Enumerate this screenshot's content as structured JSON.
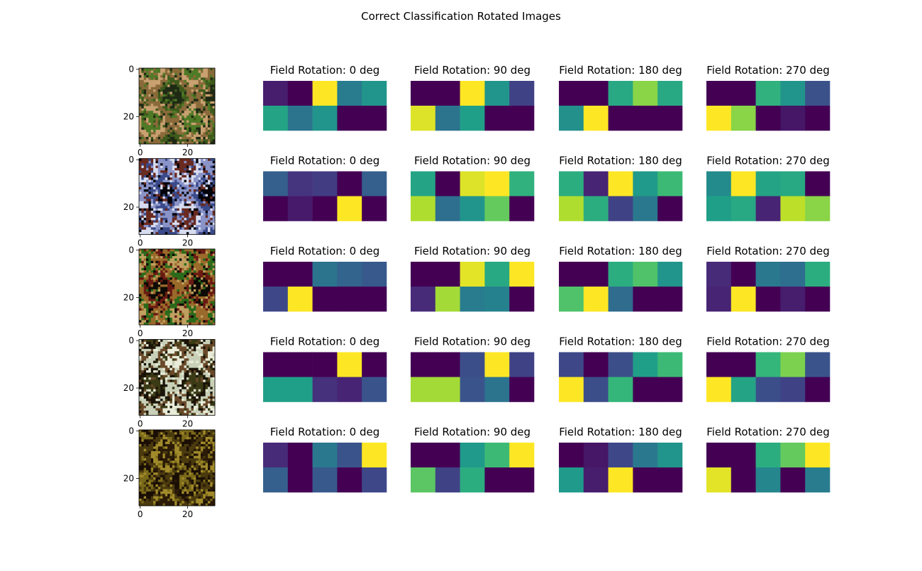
{
  "chart_data": {
    "type": "heatmap",
    "title": "Correct Classification Rotated Images",
    "colormap": "viridis",
    "value_range": [
      0,
      1
    ],
    "image_axis_ticks": [
      0,
      20
    ],
    "image_size": 32,
    "rows": [
      {
        "thumbnail": "bird-image",
        "thumb_colors": [
          "#1e2a14",
          "#3e5a1c",
          "#8a6a3a",
          "#c9a070",
          "#4e7a26"
        ],
        "panels": [
          {
            "title": "Field Rotation: 0 deg",
            "values": [
              [
                0.08,
                0.0,
                1.0,
                0.42,
                0.52
              ],
              [
                0.58,
                0.38,
                0.52,
                0.0,
                0.0
              ]
            ]
          },
          {
            "title": "Field Rotation: 90 deg",
            "values": [
              [
                0.0,
                0.0,
                1.0,
                0.52,
                0.2
              ],
              [
                0.95,
                0.38,
                0.56,
                0.0,
                0.0
              ]
            ]
          },
          {
            "title": "Field Rotation: 180 deg",
            "values": [
              [
                0.0,
                0.0,
                0.6,
                0.82,
                0.6
              ],
              [
                0.5,
                1.0,
                0.0,
                0.0,
                0.0
              ]
            ]
          },
          {
            "title": "Field Rotation: 270 deg",
            "values": [
              [
                0.0,
                0.0,
                0.64,
                0.52,
                0.25
              ],
              [
                1.0,
                0.82,
                0.0,
                0.06,
                0.0
              ]
            ]
          }
        ]
      },
      {
        "thumbnail": "boat-image",
        "thumb_colors": [
          "#02030a",
          "#3a4a8a",
          "#8a94c8",
          "#d8dcf0",
          "#6a2a20"
        ],
        "panels": [
          {
            "title": "Field Rotation: 0 deg",
            "values": [
              [
                0.3,
                0.15,
                0.18,
                0.0,
                0.3
              ],
              [
                0.0,
                0.07,
                0.0,
                1.0,
                0.0
              ]
            ]
          },
          {
            "title": "Field Rotation: 90 deg",
            "values": [
              [
                0.58,
                0.0,
                0.95,
                1.0,
                0.64
              ],
              [
                0.88,
                0.36,
                0.52,
                0.76,
                0.0
              ]
            ]
          },
          {
            "title": "Field Rotation: 180 deg",
            "values": [
              [
                0.62,
                0.1,
                1.0,
                0.54,
                0.68
              ],
              [
                0.88,
                0.62,
                0.2,
                0.4,
                0.0
              ]
            ]
          },
          {
            "title": "Field Rotation: 270 deg",
            "values": [
              [
                0.48,
                1.0,
                0.58,
                0.6,
                0.0
              ],
              [
                0.56,
                0.6,
                0.1,
                0.9,
                0.82
              ]
            ]
          }
        ]
      },
      {
        "thumbnail": "frog-image",
        "thumb_colors": [
          "#0e0a06",
          "#6a1a12",
          "#9a6a2a",
          "#2a6a1a",
          "#c0a060"
        ],
        "panels": [
          {
            "title": "Field Rotation: 0 deg",
            "values": [
              [
                0.0,
                0.0,
                0.38,
                0.32,
                0.28
              ],
              [
                0.22,
                1.0,
                0.0,
                0.0,
                0.0
              ]
            ]
          },
          {
            "title": "Field Rotation: 90 deg",
            "values": [
              [
                0.0,
                0.0,
                0.96,
                0.6,
                1.0
              ],
              [
                0.12,
                0.86,
                0.42,
                0.44,
                0.0
              ]
            ]
          },
          {
            "title": "Field Rotation: 180 deg",
            "values": [
              [
                0.0,
                0.0,
                0.62,
                0.72,
                0.52
              ],
              [
                0.72,
                1.0,
                0.35,
                0.0,
                0.0
              ]
            ]
          },
          {
            "title": "Field Rotation: 270 deg",
            "values": [
              [
                0.12,
                0.0,
                0.4,
                0.36,
                0.62
              ],
              [
                0.1,
                1.0,
                0.0,
                0.08,
                0.0
              ]
            ]
          }
        ]
      },
      {
        "thumbnail": "cat-image",
        "thumb_colors": [
          "#3a3a14",
          "#1a1408",
          "#c8d0b8",
          "#6a4a2a",
          "#e8ecd8"
        ],
        "panels": [
          {
            "title": "Field Rotation: 0 deg",
            "values": [
              [
                0.0,
                0.0,
                0.0,
                1.0,
                0.0
              ],
              [
                0.56,
                0.56,
                0.14,
                0.1,
                0.26
              ]
            ]
          },
          {
            "title": "Field Rotation: 90 deg",
            "values": [
              [
                0.0,
                0.0,
                0.24,
                1.0,
                0.2
              ],
              [
                0.86,
                0.86,
                0.26,
                0.38,
                0.0
              ]
            ]
          },
          {
            "title": "Field Rotation: 180 deg",
            "values": [
              [
                0.22,
                0.0,
                0.24,
                0.56,
                0.68
              ],
              [
                1.0,
                0.24,
                0.66,
                0.0,
                0.0
              ]
            ]
          },
          {
            "title": "Field Rotation: 270 deg",
            "values": [
              [
                0.0,
                0.0,
                0.66,
                0.8,
                0.26
              ],
              [
                1.0,
                0.58,
                0.24,
                0.2,
                0.0
              ]
            ]
          }
        ]
      },
      {
        "thumbnail": "dog-image",
        "thumb_colors": [
          "#7a6a1a",
          "#1a0e04",
          "#4a3a0e",
          "#a08a2a",
          "#2a1a06"
        ],
        "panels": [
          {
            "title": "Field Rotation: 0 deg",
            "values": [
              [
                0.12,
                0.0,
                0.4,
                0.26,
                1.0
              ],
              [
                0.3,
                0.0,
                0.28,
                0.0,
                0.22
              ]
            ]
          },
          {
            "title": "Field Rotation: 90 deg",
            "values": [
              [
                0.0,
                0.0,
                0.54,
                0.68,
                1.0
              ],
              [
                0.74,
                0.2,
                0.62,
                0.0,
                0.0
              ]
            ]
          },
          {
            "title": "Field Rotation: 180 deg",
            "values": [
              [
                0.0,
                0.06,
                0.22,
                0.4,
                0.52
              ],
              [
                0.54,
                0.08,
                1.0,
                0.0,
                0.0
              ]
            ]
          },
          {
            "title": "Field Rotation: 270 deg",
            "values": [
              [
                0.0,
                0.0,
                0.62,
                0.76,
                1.0
              ],
              [
                0.96,
                0.0,
                0.46,
                0.0,
                0.42
              ]
            ]
          }
        ]
      }
    ]
  }
}
